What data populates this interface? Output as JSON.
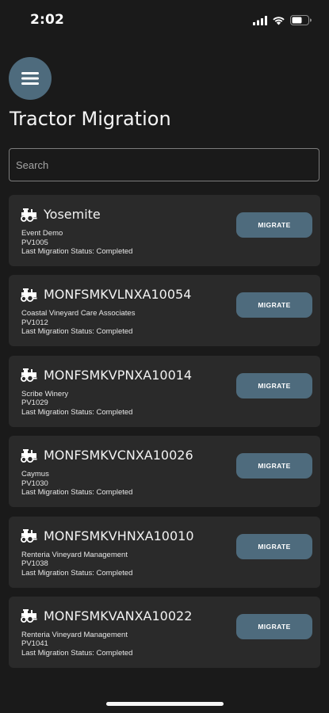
{
  "status_bar": {
    "time": "2:02",
    "icons": [
      "signal-icon",
      "wifi-icon",
      "battery-icon"
    ]
  },
  "header": {
    "menu_icon": "hamburger-menu-icon",
    "title": "Tractor Migration"
  },
  "search": {
    "placeholder": "Search",
    "value": ""
  },
  "colors": {
    "accent": "#4e6b7d",
    "background": "#1a1a1a",
    "card": "#2a2a2a"
  },
  "tractors": [
    {
      "name": "Yosemite",
      "customer": "Event Demo",
      "code": "PV1005",
      "status": "Last Migration Status: Completed",
      "button": "MIGRATE"
    },
    {
      "name": "MONFSMKVLNXA10054",
      "customer": "Coastal Vineyard Care Associates",
      "code": "PV1012",
      "status": "Last Migration Status: Completed",
      "button": "MIGRATE"
    },
    {
      "name": "MONFSMKVPNXA10014",
      "customer": "Scribe Winery",
      "code": "PV1029",
      "status": "Last Migration Status: Completed",
      "button": "MIGRATE"
    },
    {
      "name": "MONFSMKVCNXA10026",
      "customer": "Caymus",
      "code": "PV1030",
      "status": "Last Migration Status: Completed",
      "button": "MIGRATE"
    },
    {
      "name": "MONFSMKVHNXA10010",
      "customer": "Renteria Vineyard Management",
      "code": "PV1038",
      "status": "Last Migration Status: Completed",
      "button": "MIGRATE"
    },
    {
      "name": "MONFSMKVANXA10022",
      "customer": "Renteria Vineyard Management",
      "code": "PV1041",
      "status": "Last Migration Status: Completed",
      "button": "MIGRATE"
    }
  ]
}
